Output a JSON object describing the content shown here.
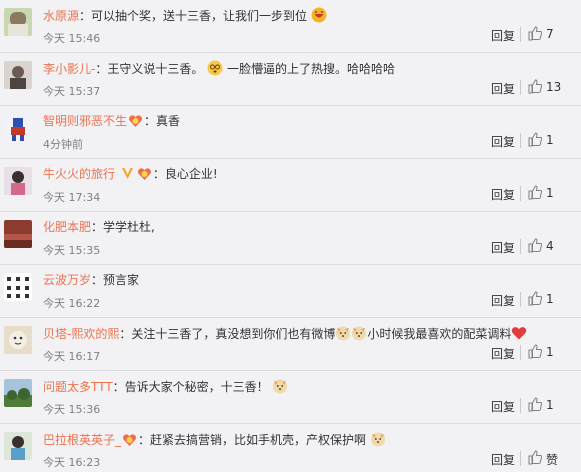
{
  "reply_label": "回复",
  "colors": {
    "name": "#eb7350",
    "text": "#333333",
    "time": "#808080",
    "background": "#f2f2f5"
  },
  "comments": [
    {
      "name": "水原源",
      "sep": "：",
      "text": "可以抽个奖，送十三香，让我们一步到位",
      "time": "今天 15:46",
      "likes": "7",
      "emoji_end": "laughing-face-icon"
    },
    {
      "name": "李小影儿-",
      "sep": "：",
      "text_a": "王守义说十三香。",
      "text_b": "一脸懵逼的上了热搜。哈哈哈哈",
      "time": "今天 15:37",
      "likes": "13"
    },
    {
      "name": "智明则邪恶不生",
      "sep": "：",
      "text": "真香",
      "time": "4分钟前",
      "likes": "1"
    },
    {
      "name": "牛火火的旅行",
      "sep": "：",
      "text": "良心企业!",
      "time": "今天 17:34",
      "likes": "1"
    },
    {
      "name": "化肥本肥",
      "sep": "：",
      "text": "学学杜杜,",
      "time": "今天 15:35",
      "likes": "4"
    },
    {
      "name": "云波万岁",
      "sep": "：",
      "text": "预言家",
      "time": "今天 16:22",
      "likes": "1"
    },
    {
      "name": "贝塔-熙欢的熙",
      "sep": "：",
      "text_a": "关注十三香了，真没想到你们也有微博",
      "text_b": "小时候我最喜欢的配菜调料",
      "time": "今天 16:17",
      "likes": "1"
    },
    {
      "name": "问题太多TTT",
      "sep": "：",
      "text": "告诉大家个秘密，十三香！",
      "time": "今天 15:36",
      "likes": "1"
    },
    {
      "name": "巴拉根英英子_",
      "sep": "：",
      "text": "赶紧去搞营销，比如手机壳，产权保护啊",
      "time": "今天 16:23",
      "likes": "赞"
    }
  ]
}
